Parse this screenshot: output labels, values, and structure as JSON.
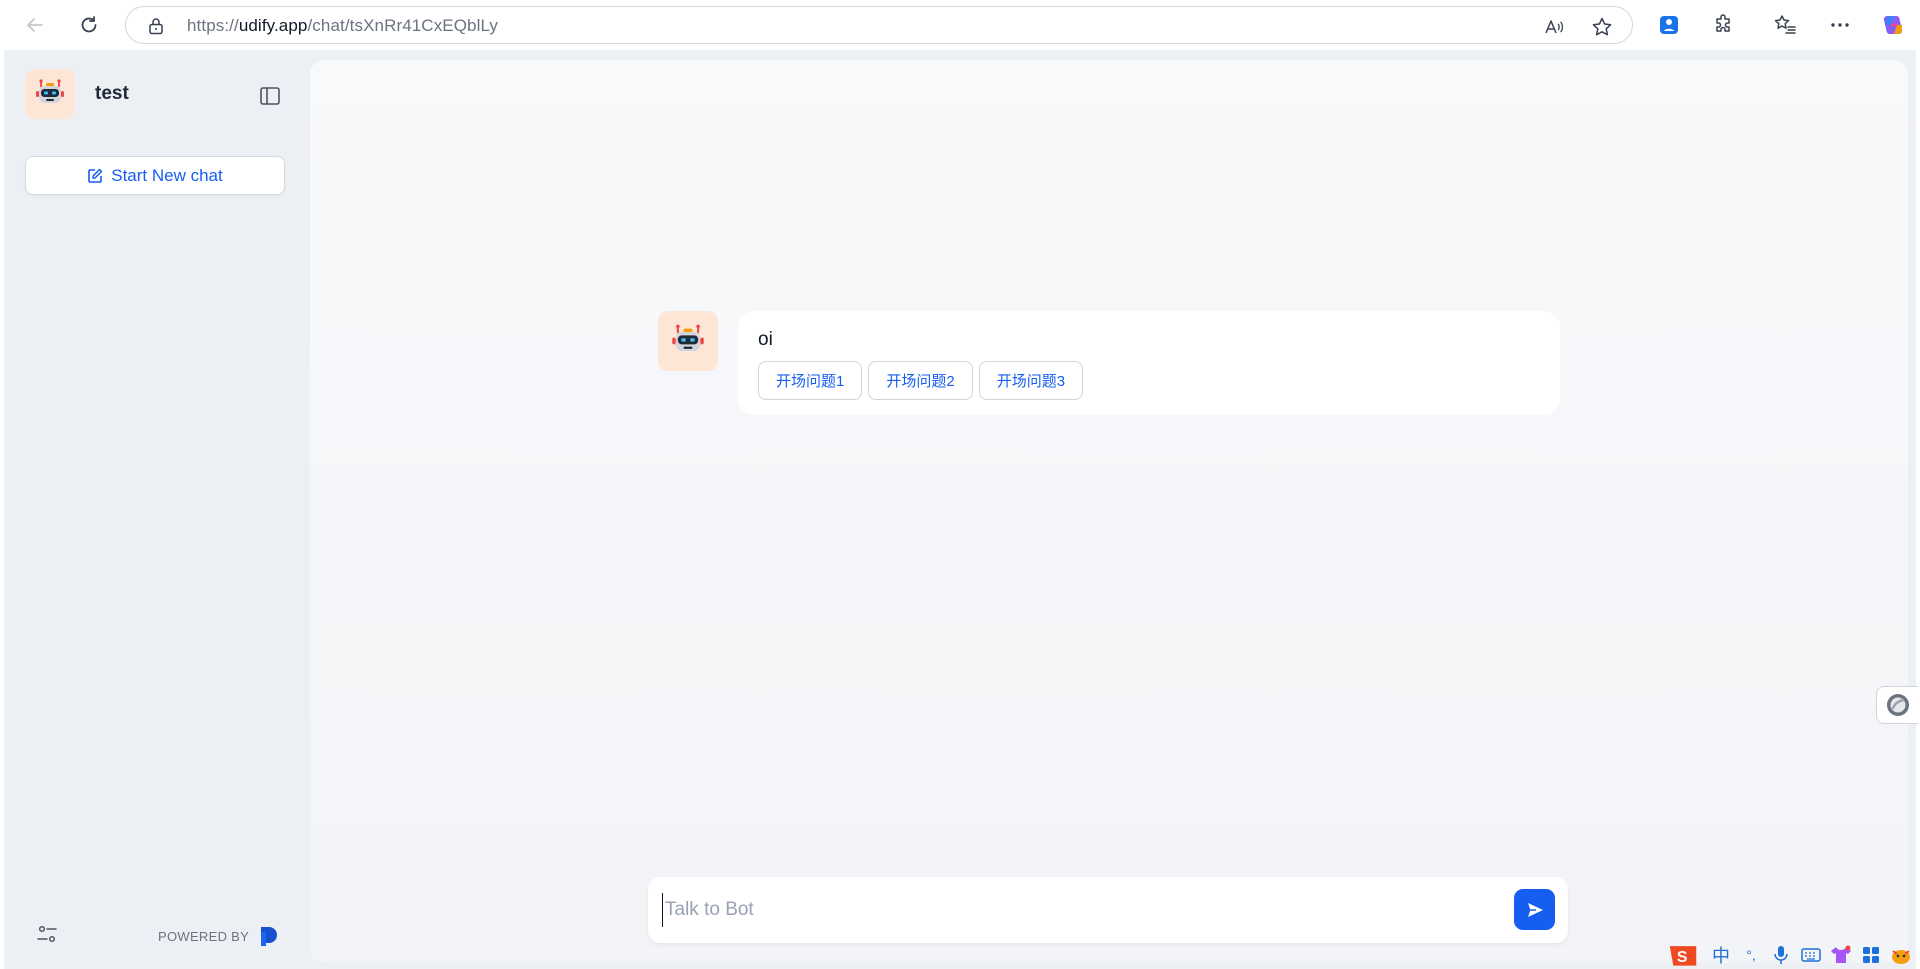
{
  "browser": {
    "url_prefix": "https://",
    "url_host": "udify.app",
    "url_path": "/chat/tsXnRr41CxEQblLy"
  },
  "sidebar": {
    "app_name": "test",
    "new_chat_label": "Start New chat",
    "powered_by_label": "POWERED BY"
  },
  "chat": {
    "greeting": "oi",
    "suggestions": [
      "开场问题1",
      "开场问题2",
      "开场问题3"
    ],
    "input_placeholder": "Talk to Bot"
  },
  "ime": {
    "mode_label": "中",
    "punct_label": "°,"
  },
  "colors": {
    "accent": "#155eef",
    "sidebar_bg": "#eceff3",
    "avatar_bg": "#fde6d5"
  }
}
